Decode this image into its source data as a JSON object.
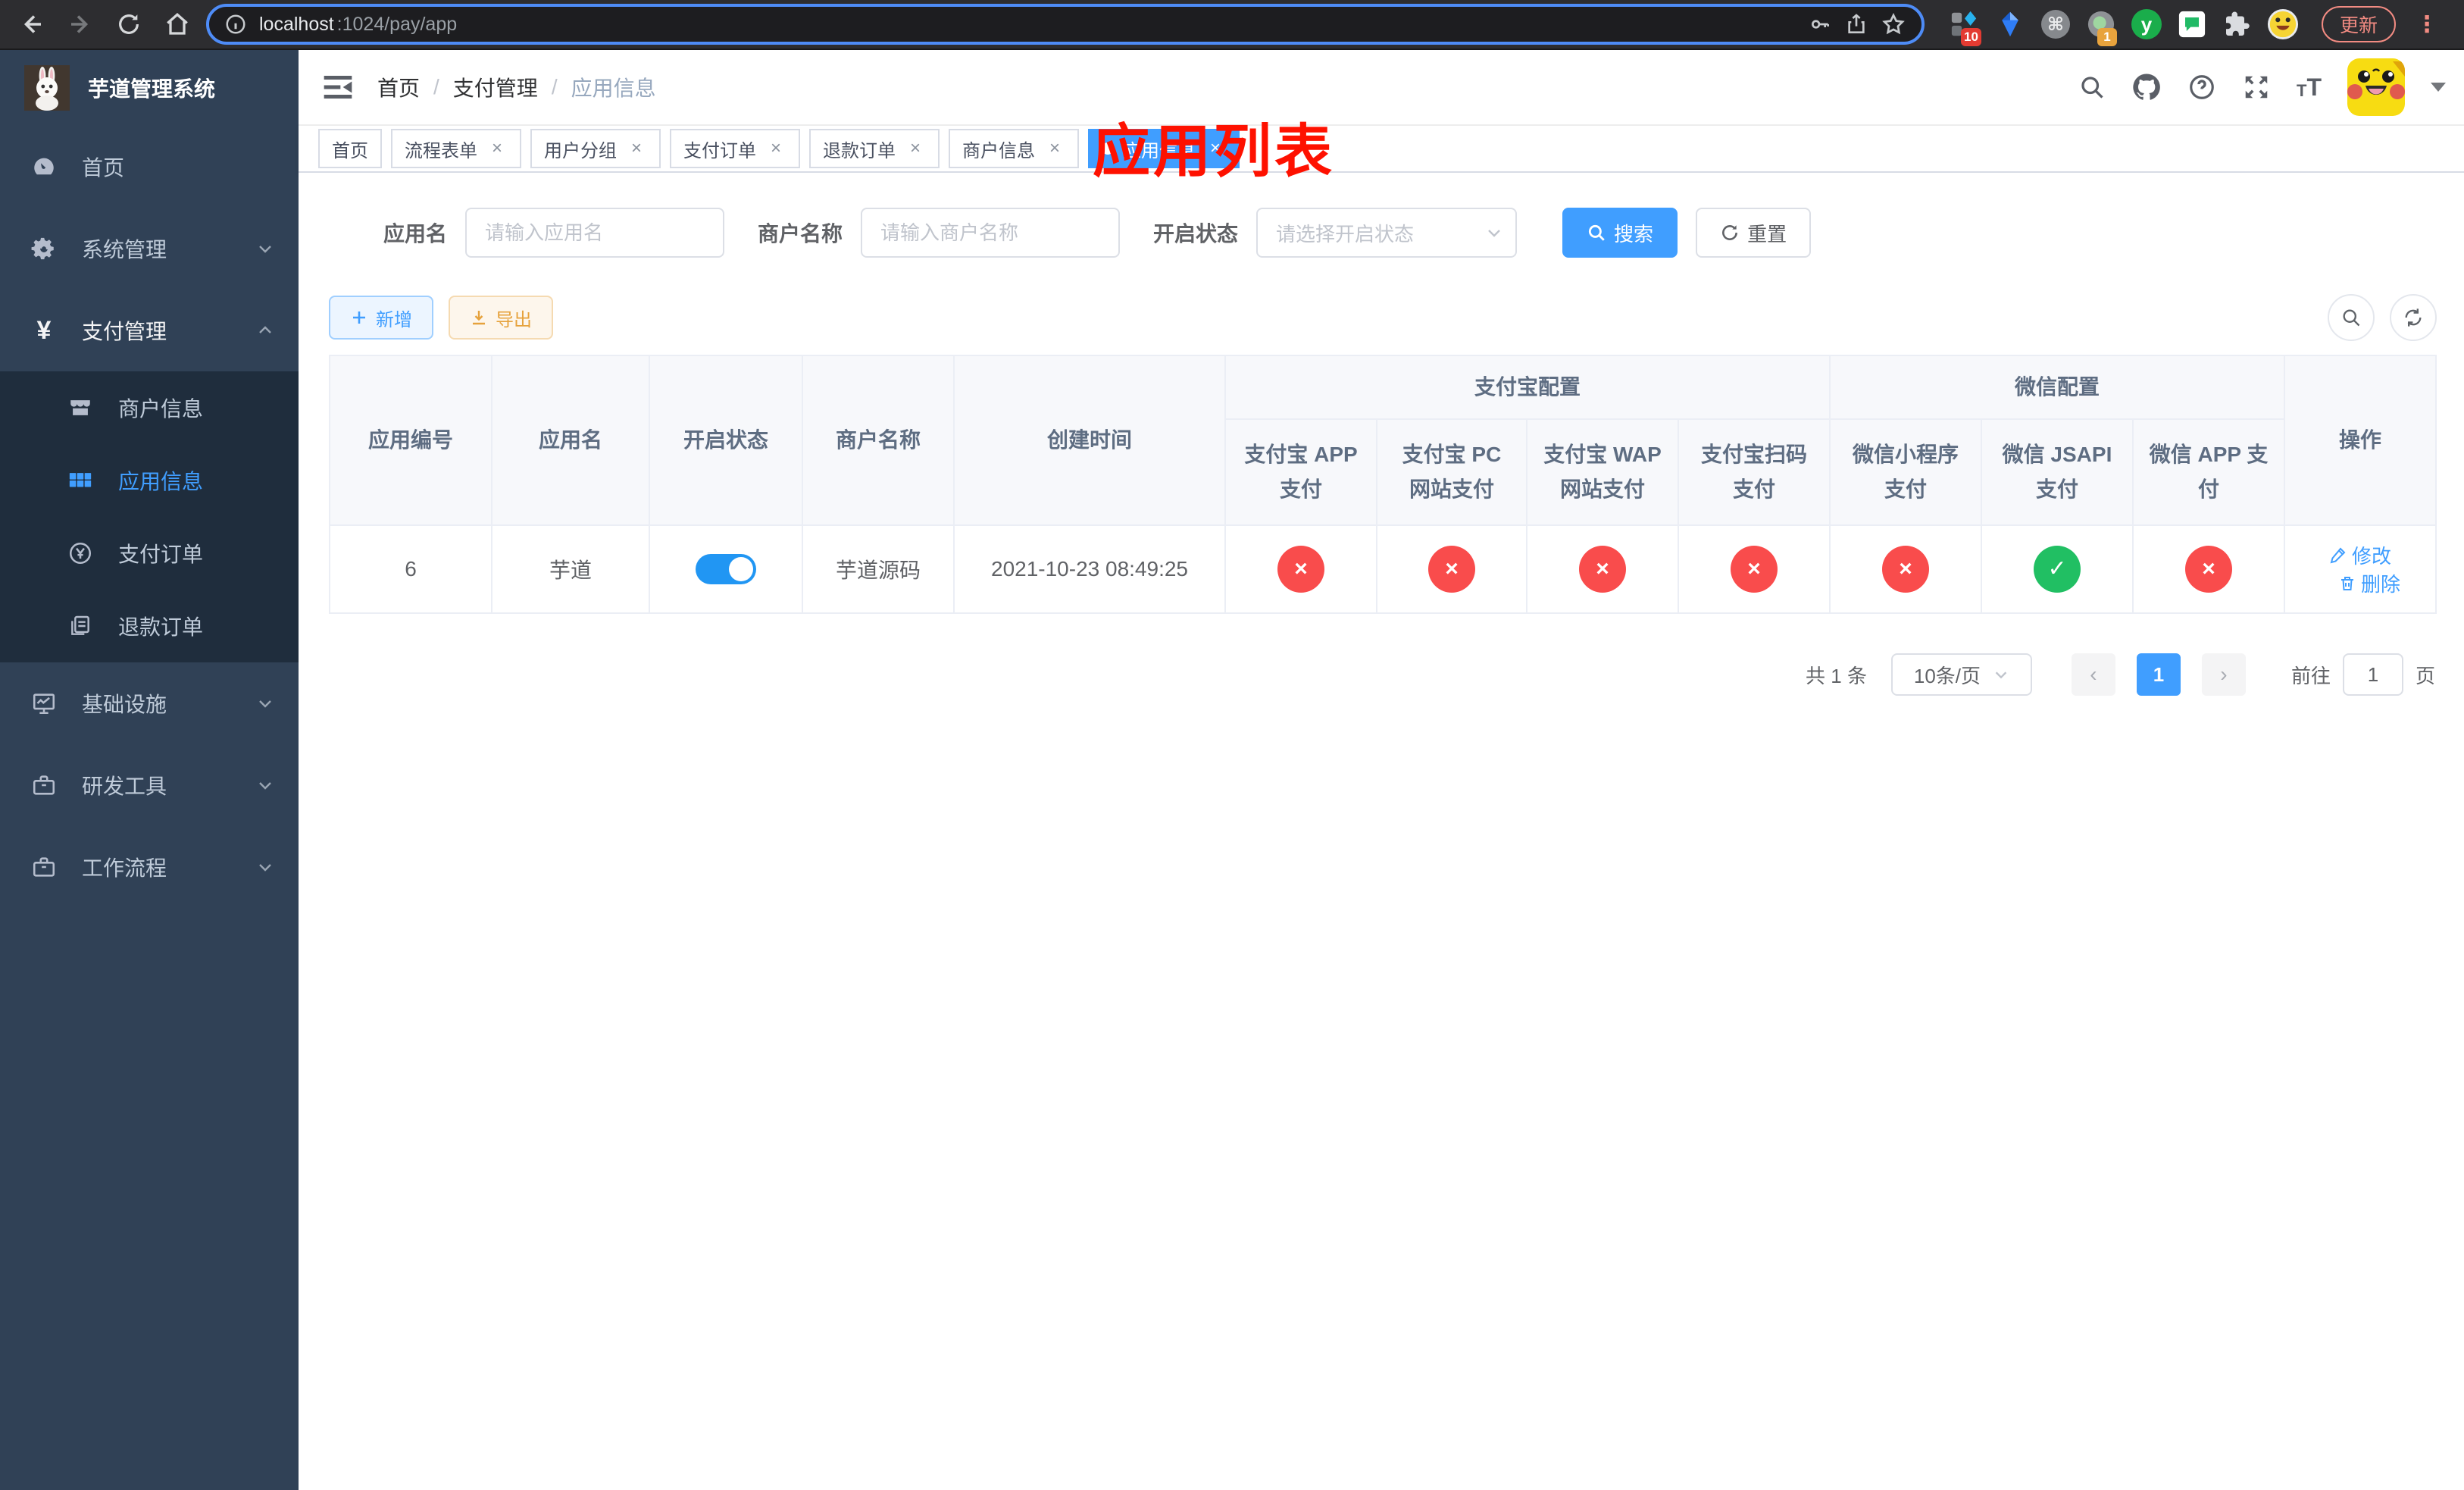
{
  "browser": {
    "url_host": "localhost",
    "url_path": ":1024/pay/app",
    "update_label": "更新",
    "ext_badge_blue_grid": "10",
    "ext_badge_tray": "1",
    "ext_letter": "y"
  },
  "sidebar": {
    "title": "芋道管理系统",
    "items": [
      {
        "label": "首页"
      },
      {
        "label": "系统管理"
      },
      {
        "label": "支付管理"
      },
      {
        "label": "商户信息"
      },
      {
        "label": "应用信息"
      },
      {
        "label": "支付订单"
      },
      {
        "label": "退款订单"
      },
      {
        "label": "基础设施"
      },
      {
        "label": "研发工具"
      },
      {
        "label": "工作流程"
      }
    ]
  },
  "header": {
    "breadcrumb": [
      "首页",
      "支付管理",
      "应用信息"
    ],
    "separator": "/",
    "annotation": "应用列表"
  },
  "tags": [
    {
      "label": "首页",
      "closable": false,
      "active": false
    },
    {
      "label": "流程表单",
      "closable": true,
      "active": false
    },
    {
      "label": "用户分组",
      "closable": true,
      "active": false
    },
    {
      "label": "支付订单",
      "closable": true,
      "active": false
    },
    {
      "label": "退款订单",
      "closable": true,
      "active": false
    },
    {
      "label": "商户信息",
      "closable": true,
      "active": false
    },
    {
      "label": "应用信息",
      "closable": true,
      "active": true
    }
  ],
  "filters": {
    "app_name_label": "应用名",
    "app_name_placeholder": "请输入应用名",
    "merchant_label": "商户名称",
    "merchant_placeholder": "请输入商户名称",
    "status_label": "开启状态",
    "status_placeholder": "请选择开启状态",
    "search_label": "搜索",
    "reset_label": "重置"
  },
  "toolbar": {
    "add_label": "新增",
    "export_label": "导出"
  },
  "table": {
    "columns": [
      "应用编号",
      "应用名",
      "开启状态",
      "商户名称",
      "创建时间"
    ],
    "groups": [
      {
        "label": "支付宝配置",
        "children": [
          "支付宝 APP 支付",
          "支付宝 PC 网站支付",
          "支付宝 WAP 网站支付",
          "支付宝扫码支付"
        ]
      },
      {
        "label": "微信配置",
        "children": [
          "微信小程序支付",
          "微信 JSAPI 支付",
          "微信 APP 支付"
        ]
      }
    ],
    "op_column": "操作",
    "rows": [
      {
        "id": "6",
        "name": "芋道",
        "enabled": true,
        "merchant": "芋道源码",
        "created": "2021-10-23 08:49:25",
        "channels": [
          false,
          false,
          false,
          false,
          false,
          true,
          false
        ],
        "edit_label": "修改",
        "delete_label": "删除"
      }
    ]
  },
  "pagination": {
    "total": "共 1 条",
    "page_size": "10条/页",
    "current_page": "1",
    "goto_label": "前往",
    "goto_value": "1",
    "page_suffix": "页"
  },
  "colors": {
    "accent": "#409eff",
    "danger": "#f94c4c",
    "success": "#21bf63",
    "sidebar_bg": "#304156",
    "submenu_bg": "#1f2d3d",
    "annotation": "#fe1100"
  }
}
